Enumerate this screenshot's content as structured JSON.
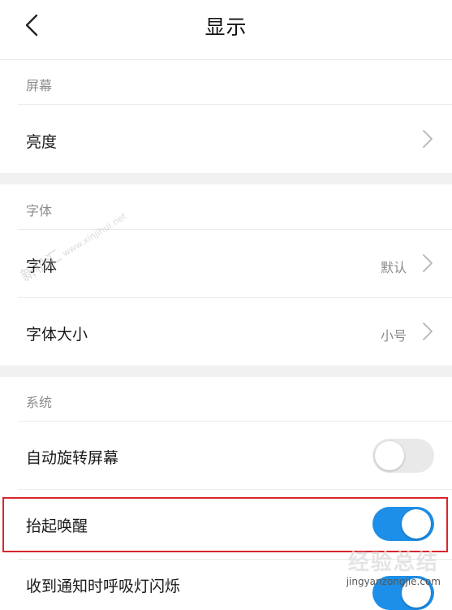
{
  "header": {
    "title": "显示"
  },
  "sections": [
    {
      "label": "屏幕",
      "rows": [
        {
          "label": "亮度",
          "value": ""
        }
      ]
    },
    {
      "label": "字体",
      "rows": [
        {
          "label": "字体",
          "value": "默认"
        },
        {
          "label": "字体大小",
          "value": "小号"
        }
      ]
    },
    {
      "label": "系统",
      "rows": [
        {
          "label": "自动旋转屏幕",
          "toggle": "off"
        },
        {
          "label": "抬起唤醒",
          "toggle": "on"
        },
        {
          "label": "收到通知时呼吸灯闪烁",
          "toggle": "on"
        }
      ]
    }
  ],
  "colors": {
    "accent": "#1e8fe8",
    "highlight_border": "#d9262c",
    "section_gap": "#f1f1f1"
  },
  "watermarks": {
    "diagonal": "新机汇",
    "diagonal_url": "www.xinjihui.net",
    "brand": "经验总结",
    "brand_url": "jingyanzongjie.com"
  }
}
